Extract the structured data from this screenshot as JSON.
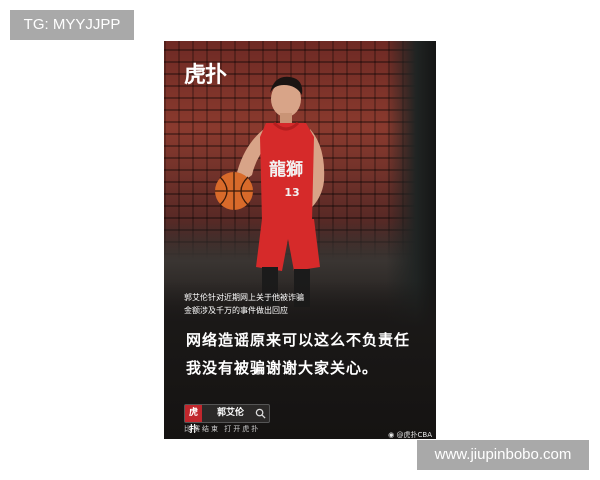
{
  "overlay_tags": {
    "top_left": "TG: MYYJJPP",
    "bottom_right": "www.jiupinbobo.com"
  },
  "poster": {
    "logo_text": "虎扑",
    "jersey_text": "龍獅",
    "jersey_number": "13",
    "caption_lines": [
      "郭艾伦针对近期网上关于他被诈骗",
      "金额涉及千万的事件做出回应"
    ],
    "headline_lines": [
      "网络造谣原来可以这么不负责任",
      "我没有被骗谢谢大家关心。"
    ],
    "search": {
      "logo": "虎扑",
      "query": "郭艾伦",
      "sub_links": "比赛结束 打开虎扑"
    },
    "watermark": "@虎扑CBA"
  },
  "colors": {
    "jersey_red": "#d62a2a",
    "tag_bg": "#a9a9a9",
    "poster_bg": "#1d1a19"
  },
  "icons": [
    "search-icon",
    "weibo-icon"
  ]
}
